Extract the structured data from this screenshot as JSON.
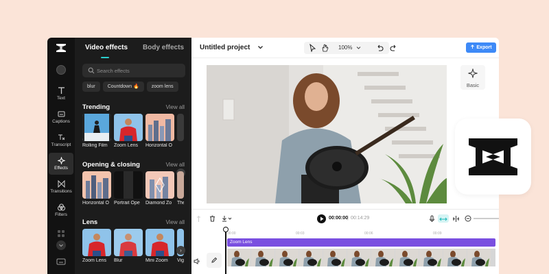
{
  "rail": {
    "items": [
      {
        "label": "Text",
        "icon": "text-icon"
      },
      {
        "label": "Captions",
        "icon": "captions-icon"
      },
      {
        "label": "Transcript",
        "icon": "transcript-icon"
      },
      {
        "label": "Effects",
        "icon": "effects-icon",
        "active": true
      },
      {
        "label": "Transitions",
        "icon": "transitions-icon"
      },
      {
        "label": "Filters",
        "icon": "filters-icon"
      }
    ]
  },
  "panel": {
    "tabs": {
      "video": "Video effects",
      "body": "Body effects"
    },
    "search_placeholder": "Search effects",
    "chips": [
      "blur",
      "Countdown 🔥",
      "zoom lens"
    ],
    "sections": [
      {
        "title": "Trending",
        "view_all": "View all",
        "items": [
          "Rolling Film",
          "Zoom Lens",
          "Horizontal O"
        ]
      },
      {
        "title": "Opening & closing",
        "view_all": "View all",
        "items": [
          "Horizontal O",
          "Portrait Ope",
          "Diamond Zo",
          "The"
        ]
      },
      {
        "title": "Lens",
        "view_all": "View all",
        "items": [
          "Zoom Lens",
          "Blur",
          "Mini Zoom",
          "Vig"
        ]
      }
    ]
  },
  "topbar": {
    "project": "Untitled project",
    "zoom": "100%",
    "export": "Export"
  },
  "inspector": {
    "basic": "Basic"
  },
  "timeline": {
    "current_time": "00:00:00",
    "separator": "|",
    "duration": "00:14:29",
    "track_label": "Zoom Lens",
    "ruler": [
      "00:00",
      "00:03",
      "00:06",
      "00:09",
      "00:12"
    ]
  },
  "colors": {
    "accent": "#2bd0cf",
    "export": "#3e8af7",
    "track": "#7a4fe0",
    "background": "#fbe4d8"
  }
}
